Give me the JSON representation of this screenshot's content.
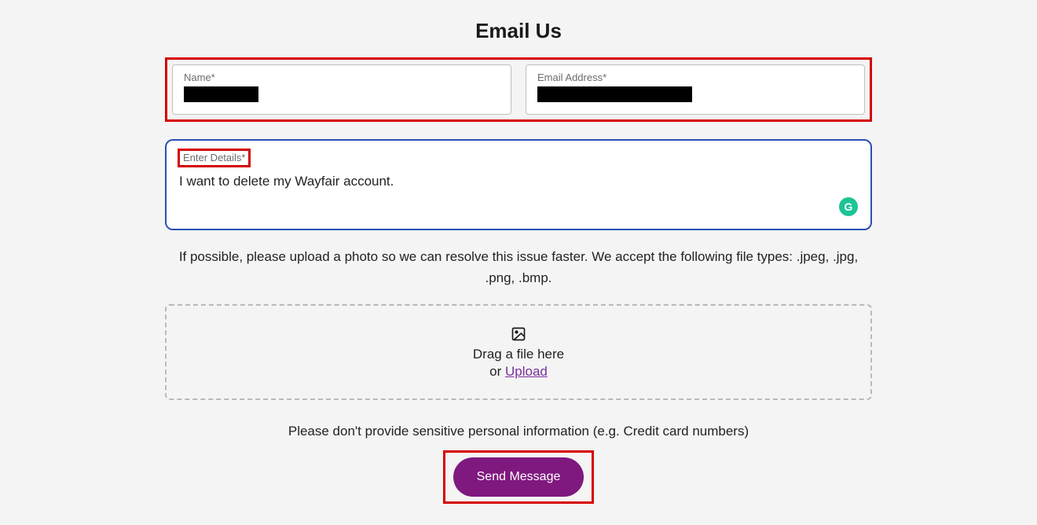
{
  "heading": "Email Us",
  "fields": {
    "name": {
      "label": "Name*"
    },
    "email": {
      "label": "Email Address*"
    }
  },
  "details": {
    "label": "Enter Details*",
    "value": "I want to delete my Wayfair account."
  },
  "upload_hint": "If possible, please upload a photo so we can resolve this issue faster. We accept the following file types: .jpeg, .jpg, .png, .bmp.",
  "dropzone": {
    "line1": "Drag a file here",
    "or": "or ",
    "upload": "Upload"
  },
  "privacy_note": "Please don't provide sensitive personal information (e.g. Credit card numbers)",
  "send_button": "Send Message",
  "grammarly": "G"
}
